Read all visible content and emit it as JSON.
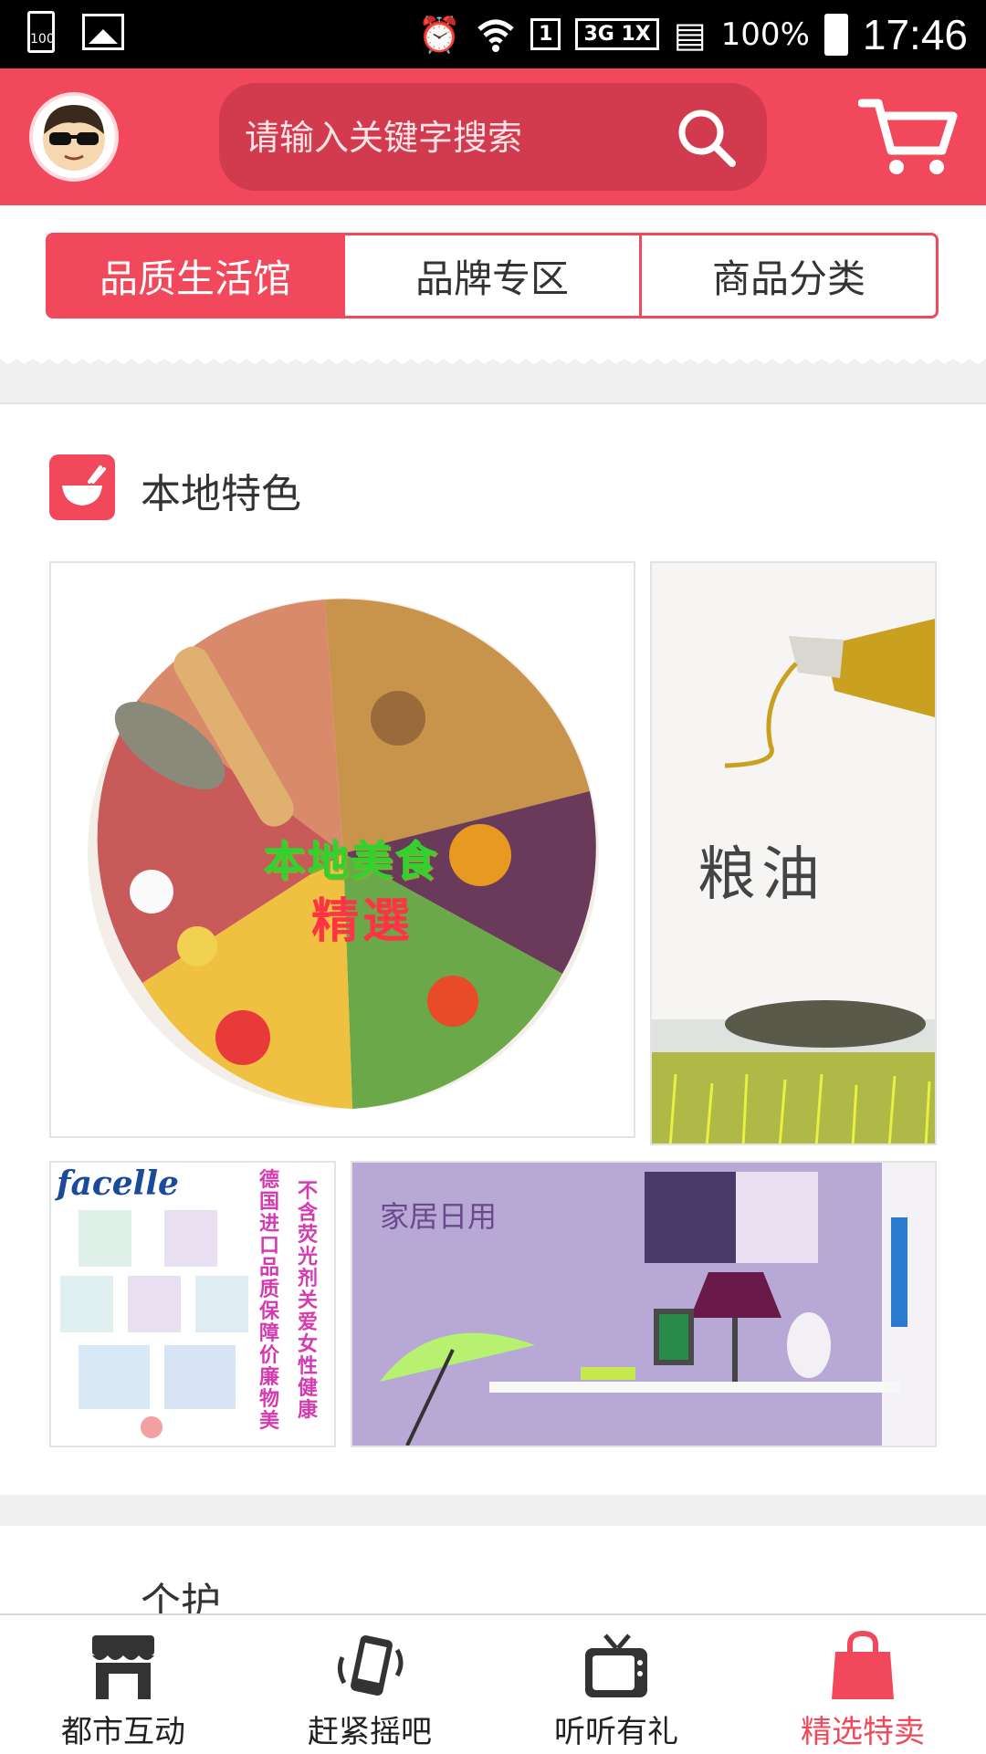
{
  "status_bar": {
    "battery_small": "100",
    "sim_slot": "1",
    "network": "3G 1X",
    "battery_percent": "100%",
    "time": "17:46"
  },
  "header": {
    "search_placeholder": "请输入关键字搜索"
  },
  "tabs": [
    {
      "label": "品质生活馆",
      "active": true
    },
    {
      "label": "品牌专区",
      "active": false
    },
    {
      "label": "商品分类",
      "active": false
    }
  ],
  "section_local": {
    "title": "本地特色",
    "icon": "bowl-icon",
    "tiles": {
      "food": {
        "line1": "本地美食",
        "line2": "精選"
      },
      "oil": {
        "text": "粮油"
      },
      "facelle": {
        "brand": "facelle",
        "col1": "德国进口品质保障价廉物美",
        "col2": "不含荧光剂关爱女性健康"
      },
      "home": {
        "text": "家居日用"
      }
    }
  },
  "section_personal": {
    "title": "个护"
  },
  "bottom_nav": [
    {
      "label": "都市互动",
      "icon": "storefront-icon",
      "active": false
    },
    {
      "label": "赶紧摇吧",
      "icon": "shake-phone-icon",
      "active": false
    },
    {
      "label": "听听有礼",
      "icon": "tv-icon",
      "active": false
    },
    {
      "label": "精选特卖",
      "icon": "shopping-bag-icon",
      "active": true
    }
  ],
  "colors": {
    "accent": "#f1485b",
    "search_bg": "#d23b4d"
  }
}
